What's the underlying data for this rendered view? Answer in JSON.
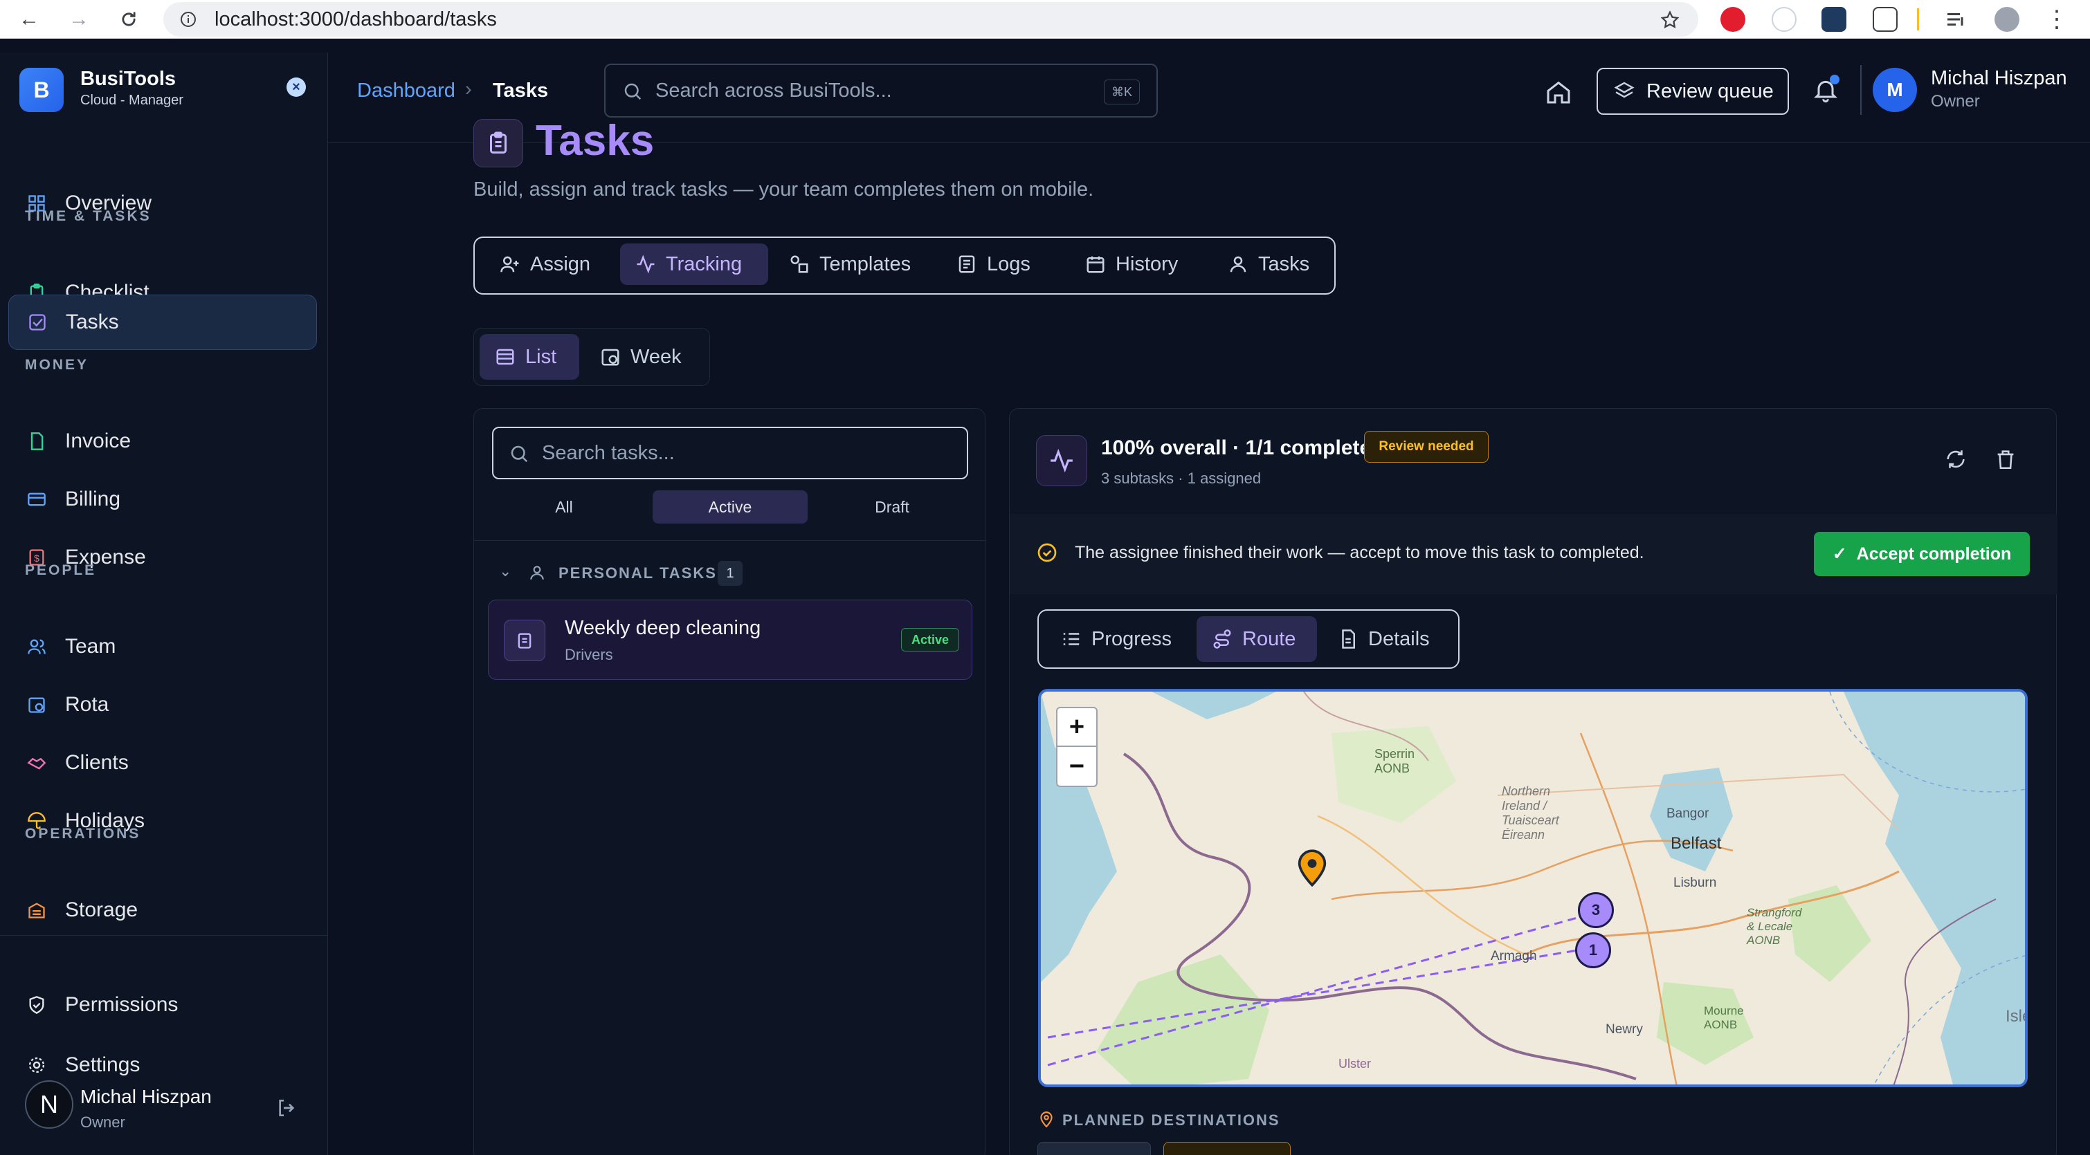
{
  "browser": {
    "url": "localhost:3000/dashboard/tasks"
  },
  "app": {
    "logo_letter": "B",
    "name": "BusiTools",
    "subtitle": "Cloud - Manager"
  },
  "sidebar": {
    "overview": "Overview",
    "sections": {
      "time_tasks": "TIME & TASKS",
      "money": "MONEY",
      "people": "PEOPLE",
      "operations": "OPERATIONS"
    },
    "items": {
      "checklist": "Checklist",
      "tasks": "Tasks",
      "invoice": "Invoice",
      "billing": "Billing",
      "expense": "Expense",
      "team": "Team",
      "rota": "Rota",
      "clients": "Clients",
      "holidays": "Holidays",
      "storage": "Storage",
      "permissions": "Permissions",
      "settings": "Settings"
    },
    "user": {
      "initial": "N",
      "name": "Michal Hiszpan",
      "role": "Owner"
    }
  },
  "topbar": {
    "breadcrumb_root": "Dashboard",
    "breadcrumb_current": "Tasks",
    "search_placeholder": "Search across BusiTools...",
    "search_shortcut": "⌘K",
    "review_queue": "Review queue",
    "user": {
      "initial": "M",
      "name": "Michal Hiszpan",
      "role": "Owner"
    }
  },
  "page": {
    "title": "Tasks",
    "subtitle": "Build, assign and track tasks — your team completes them on mobile.",
    "tabs": [
      "Assign",
      "Tracking",
      "Templates",
      "Logs",
      "History",
      "Tasks"
    ],
    "active_tab": "Tracking",
    "view_toggle": [
      "List",
      "Week"
    ],
    "active_view": "List"
  },
  "task_list": {
    "search_placeholder": "Search tasks...",
    "filters": [
      "All",
      "Active",
      "Draft"
    ],
    "active_filter": "Active",
    "group_label": "PERSONAL TASKS",
    "group_count": "1",
    "tasks": [
      {
        "title": "Weekly deep cleaning",
        "subtitle": "Drivers",
        "status": "Active"
      }
    ]
  },
  "task_detail": {
    "headline": "100% overall · 1/1 complete",
    "badge": "Review needed",
    "meta": "3 subtasks · 1 assigned",
    "notice": "The assignee finished their work — accept to move this task to completed.",
    "accept_label": "Accept completion",
    "tabs": [
      "Progress",
      "Route",
      "Details"
    ],
    "active_tab": "Route",
    "planned_destinations": "PLANNED DESTINATIONS"
  },
  "map": {
    "zoom_in": "+",
    "zoom_out": "−",
    "markers": [
      "3",
      "1"
    ],
    "labels": {
      "sperrin": "Sperrin\nAONB",
      "northern_ireland": "Northern\nIreland /\nTuaisceart\nÉireann",
      "belfast": "Belfast",
      "bangor": "Bangor",
      "lisburn": "Lisburn",
      "armagh": "Armagh",
      "newry": "Newry",
      "strangford": "Strangford\n& Lecale\nAONB",
      "mourne": "Mourne\nAONB",
      "ulster": "Ulster",
      "isle": "Isle"
    }
  },
  "colors": {
    "accent": "#8b5cf6",
    "accept_green": "#16a34a",
    "review_amber": "#fbbf24",
    "link_blue": "#60a5fa"
  }
}
